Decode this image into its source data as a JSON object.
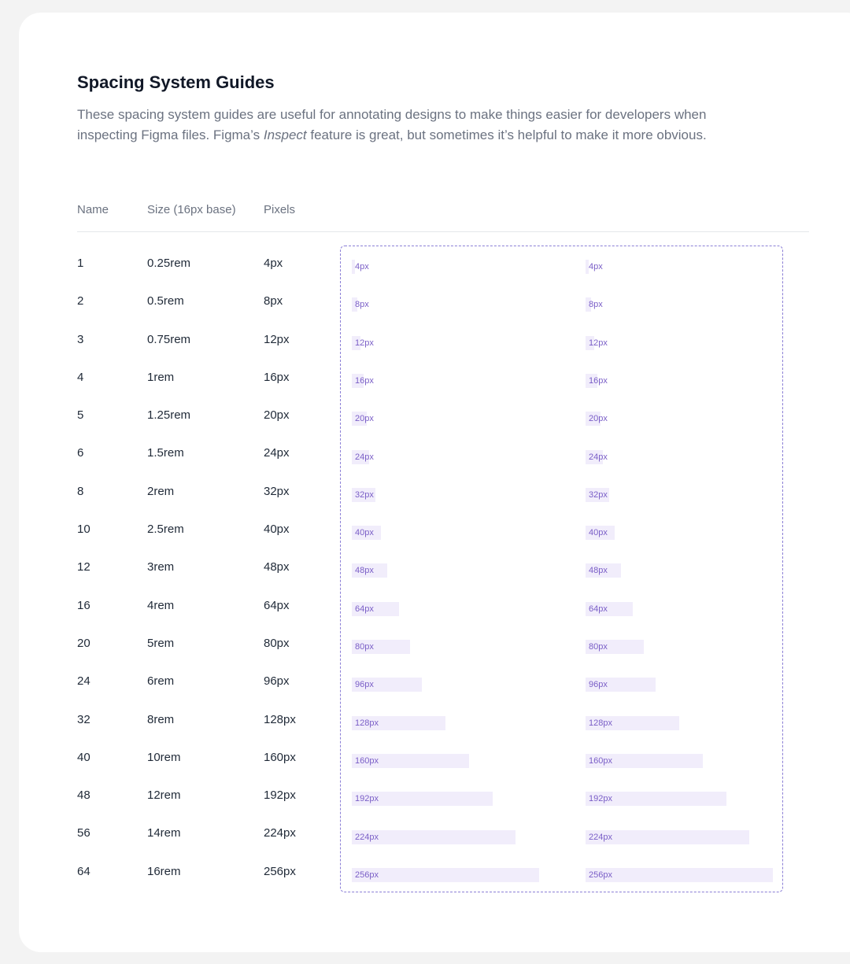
{
  "header": {
    "title": "Spacing System Guides",
    "description_before": "These spacing system guides are useful for annotating designs to make things easier for developers when inspecting Figma files. Figma’s ",
    "description_italic": "Inspect",
    "description_after": " feature is great, but sometimes it’s helpful to make it more obvious."
  },
  "table": {
    "columns": {
      "name": "Name",
      "size": "Size (16px base)",
      "pixels": "Pixels"
    },
    "rows": [
      {
        "name": "1",
        "size": "0.25rem",
        "pixels": "4px",
        "value": 4
      },
      {
        "name": "2",
        "size": "0.5rem",
        "pixels": "8px",
        "value": 8
      },
      {
        "name": "3",
        "size": "0.75rem",
        "pixels": "12px",
        "value": 12
      },
      {
        "name": "4",
        "size": "1rem",
        "pixels": "16px",
        "value": 16
      },
      {
        "name": "5",
        "size": "1.25rem",
        "pixels": "20px",
        "value": 20
      },
      {
        "name": "6",
        "size": "1.5rem",
        "pixels": "24px",
        "value": 24
      },
      {
        "name": "8",
        "size": "2rem",
        "pixels": "32px",
        "value": 32
      },
      {
        "name": "10",
        "size": "2.5rem",
        "pixels": "40px",
        "value": 40
      },
      {
        "name": "12",
        "size": "3rem",
        "pixels": "48px",
        "value": 48
      },
      {
        "name": "16",
        "size": "4rem",
        "pixels": "64px",
        "value": 64
      },
      {
        "name": "20",
        "size": "5rem",
        "pixels": "80px",
        "value": 80
      },
      {
        "name": "24",
        "size": "6rem",
        "pixels": "96px",
        "value": 96
      },
      {
        "name": "32",
        "size": "8rem",
        "pixels": "128px",
        "value": 128
      },
      {
        "name": "40",
        "size": "10rem",
        "pixels": "160px",
        "value": 160
      },
      {
        "name": "48",
        "size": "12rem",
        "pixels": "192px",
        "value": 192
      },
      {
        "name": "56",
        "size": "14rem",
        "pixels": "224px",
        "value": 224
      },
      {
        "name": "64",
        "size": "16rem",
        "pixels": "256px",
        "value": 256
      }
    ]
  },
  "colors": {
    "bar_fill": "#f1edfb",
    "bar_text": "#7a5ec7",
    "guide_border": "#8b7fd6"
  }
}
